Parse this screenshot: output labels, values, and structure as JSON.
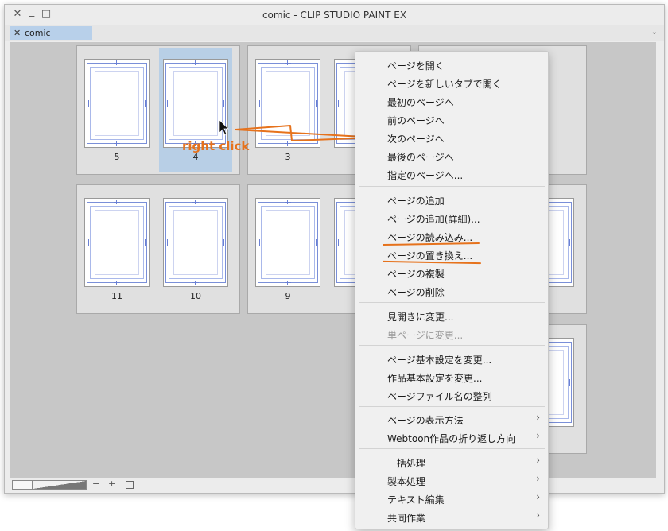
{
  "window": {
    "title": "comic - CLIP STUDIO PAINT EX",
    "close": "✕",
    "minimize": "_",
    "maximize": "□"
  },
  "tab": {
    "label": "comic",
    "close": "✕",
    "menu": "⌄"
  },
  "pages": {
    "row1": [
      "5",
      "4",
      "3"
    ],
    "row2": [
      "11",
      "10",
      "9"
    ]
  },
  "annotation": {
    "text": "right click",
    "color": "#e6721c"
  },
  "bottombar": {
    "minus": "−",
    "plus": "+"
  },
  "menu": {
    "items": [
      "ページを開く",
      "ページを新しいタブで開く",
      "最初のページへ",
      "前のページへ",
      "次のページへ",
      "最後のページへ",
      "指定のページへ...",
      "ページの追加",
      "ページの追加(詳細)...",
      "ページの読み込み...",
      "ページの置き換え...",
      "ページの複製",
      "ページの削除",
      "見開きに変更...",
      "単ページに変更...",
      "ページ基本設定を変更...",
      "作品基本設定を変更...",
      "ページファイル名の整列",
      "ページの表示方法",
      "Webtoon作品の折り返し方向",
      "一括処理",
      "製本処理",
      "テキスト編集",
      "共同作業"
    ],
    "submenu_arrow": "›"
  },
  "colors": {
    "selection": "#b8cfe6",
    "canvas": "#c7c7c7",
    "accent": "#e6721c",
    "guide": "#6a80d4"
  }
}
